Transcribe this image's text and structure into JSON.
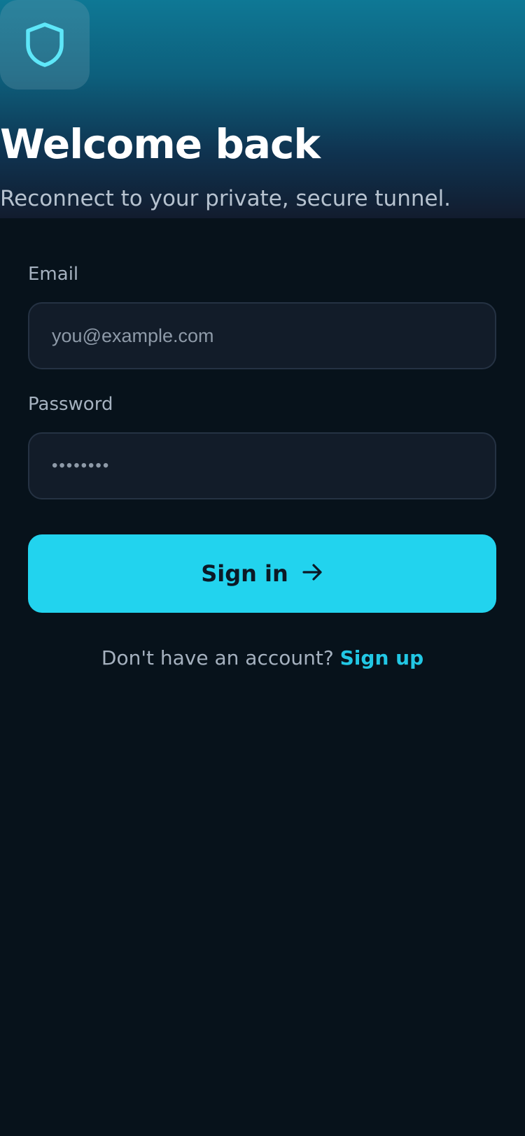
{
  "header": {
    "logo_icon": "shield-icon",
    "title": "Welcome back",
    "subtitle": "Reconnect to your private, secure tunnel."
  },
  "form": {
    "email": {
      "label": "Email",
      "placeholder": "you@example.com",
      "value": ""
    },
    "password": {
      "label": "Password",
      "value": "••••••••"
    },
    "submit": {
      "label": "Sign in",
      "icon": "arrow-right-icon"
    }
  },
  "footer": {
    "prompt": "Don't have an account?",
    "link_label": "Sign up"
  },
  "colors": {
    "accent": "#22d3ee",
    "background": "#07121b",
    "input_background": "#121c29",
    "header_gradient_top": "#0e7895"
  }
}
